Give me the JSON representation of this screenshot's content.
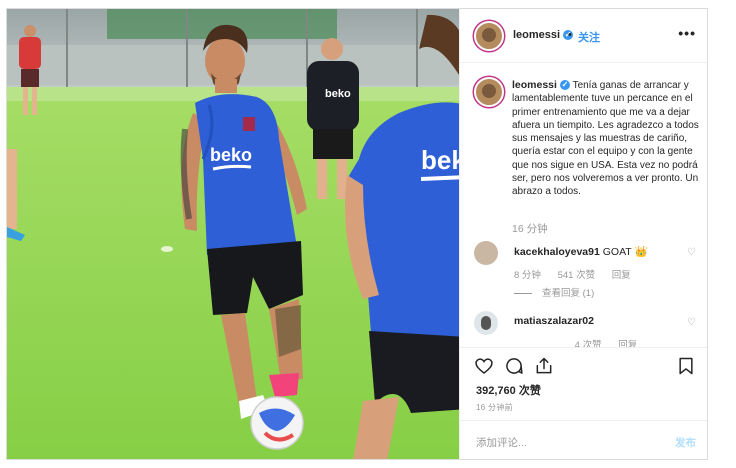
{
  "post": {
    "username": "leomessi",
    "follow_label": "关注",
    "dot": "•",
    "more_label": "•••",
    "verified_mark": "✓",
    "caption": "Tenía ganas de arrancar y lamentablemente tuve un percance en el primer entrenamiento que me va a dejar afuera un tiempito. Les agradezco a todos sus mensajes y las muestras de cariño, quería estar con el equipo y con la gente que nos sigue en USA. Esta vez no podrá ser, pero nos volveremos a ver pronto. Un abrazo a todos.",
    "caption_time": "16 分钟",
    "likes": "392,760 次赞",
    "post_time": "16 分钟前",
    "add_comment_placeholder": "添加评论...",
    "post_button": "发布"
  },
  "photo": {
    "jersey_sponsor_1": "beko",
    "jersey_sponsor_2": "beko",
    "jersey_sponsor_3": "bek"
  },
  "comments": [
    {
      "username": "kacekhaloyeva91",
      "text": "GOAT 👑",
      "time": "8 分钟",
      "likes": "541 次赞",
      "reply_label": "回复",
      "view_replies": "查看回复 (1)"
    },
    {
      "username": "matiaszalazar02",
      "text": "",
      "time": "",
      "likes": "4 次赞",
      "reply_label": "回复"
    }
  ],
  "icons": [
    "heart-icon",
    "comment-icon",
    "share-icon",
    "bookmark-icon",
    "more-icon",
    "verified-badge-icon"
  ],
  "colors": {
    "accent": "#3897f0",
    "jersey": "#2e5fd6",
    "grass": "#8fd64a",
    "muted": "#999999"
  }
}
